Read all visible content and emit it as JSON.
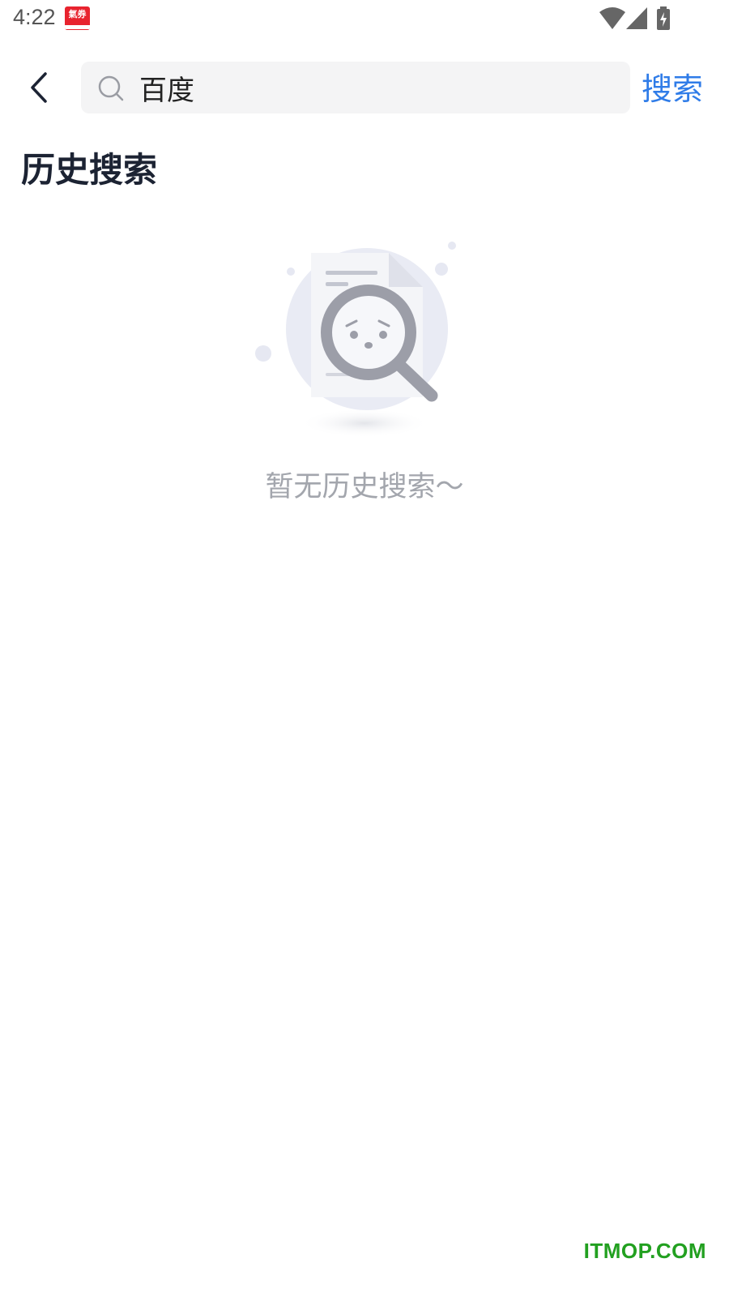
{
  "status_bar": {
    "time": "4:22",
    "app_icon_label": "氣券",
    "icons": [
      "wifi-icon",
      "signal-icon",
      "battery-charging-icon"
    ]
  },
  "header": {
    "back_icon": "chevron-left-icon",
    "search": {
      "icon": "search-icon",
      "value": "百度"
    },
    "search_button_label": "搜索"
  },
  "history": {
    "title": "历史搜索",
    "empty_illustration": "empty-search-illustration",
    "empty_text": "暂无历史搜索～"
  },
  "watermark": "ITMOP.COM",
  "colors": {
    "accent": "#2f7ce8",
    "title": "#1c2333",
    "muted": "#a3a6ad",
    "search_bg": "#f4f4f5",
    "watermark": "#22a020"
  }
}
